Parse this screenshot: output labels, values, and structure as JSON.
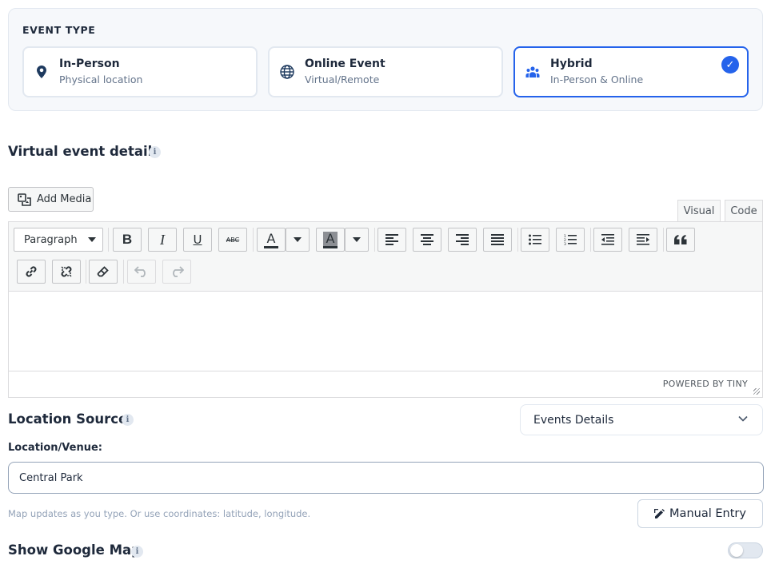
{
  "event_type": {
    "title": "EVENT TYPE",
    "options": [
      {
        "label": "In-Person",
        "sub": "Physical location",
        "icon": "map-pin-icon",
        "selected": false
      },
      {
        "label": "Online Event",
        "sub": "Virtual/Remote",
        "icon": "globe-icon",
        "selected": false
      },
      {
        "label": "Hybrid",
        "sub": "In-Person & Online",
        "icon": "users-icon",
        "selected": true
      }
    ],
    "check_glyph": "✓"
  },
  "virtual": {
    "heading": "Virtual event details",
    "info": "i"
  },
  "editor": {
    "add_media_label": "Add Media",
    "tab_visual": "Visual",
    "tab_code": "Code",
    "format_select": "Paragraph",
    "text_color_glyph": "A",
    "bg_color_glyph": "A",
    "powered_by": "POWERED BY TINY"
  },
  "location": {
    "heading": "Location Source:",
    "info": "i",
    "source_value": "Events Details",
    "venue_label": "Location/Venue:",
    "venue_value": "Central Park",
    "hint": "Map updates as you type. Or use coordinates: latitude, longitude.",
    "manual_label": "Manual Entry"
  },
  "map": {
    "heading": "Show Google Map",
    "info": "i",
    "enabled": false
  },
  "colors": {
    "accent": "#2563eb",
    "border": "#e2e8f0",
    "text": "#1e293b",
    "muted": "#64748b"
  }
}
